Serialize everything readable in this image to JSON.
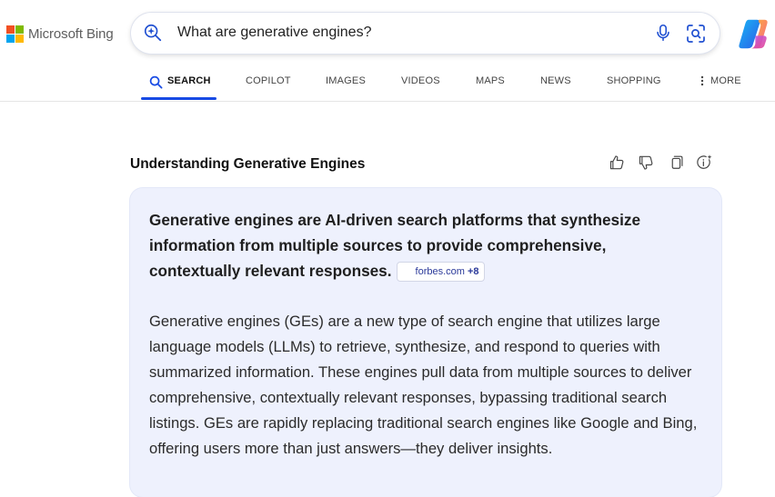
{
  "brand": {
    "logo_text": "Microsoft Bing",
    "logo_colors": [
      "#f25022",
      "#7fba00",
      "#00a4ef",
      "#ffb900"
    ]
  },
  "search": {
    "query": "What are generative engines?",
    "left_icon": "copilot-search-icon",
    "mic_icon": "microphone-icon",
    "visual_icon": "visual-search-icon"
  },
  "copilot_button_icon": "copilot-logo-icon",
  "tabs": [
    {
      "label": "SEARCH",
      "active": true,
      "icon": "search-icon"
    },
    {
      "label": "COPILOT"
    },
    {
      "label": "IMAGES"
    },
    {
      "label": "VIDEOS"
    },
    {
      "label": "MAPS"
    },
    {
      "label": "NEWS"
    },
    {
      "label": "SHOPPING"
    },
    {
      "label": "MORE",
      "icon": "more-vertical-icon"
    }
  ],
  "answer": {
    "heading": "Understanding Generative Engines",
    "feedback_icons": [
      "thumbs-up-icon",
      "thumbs-down-icon",
      "copy-icon",
      "sparkle-info-icon"
    ],
    "summary": "Generative engines are AI-driven search platforms that synthesize information from multiple sources to provide comprehensive, contextually relevant responses.",
    "citation": {
      "source": "forbes.com",
      "more": "+8"
    },
    "detail": "Generative engines (GEs) are a new type of search engine that utilizes large language models (LLMs) to retrieve, synthesize, and respond to queries with summarized information. These engines pull data from multiple sources to deliver comprehensive, contextually relevant responses, bypassing traditional search listings. GEs are rapidly replacing traditional search engines like Google and Bing, offering users more than just answers—they deliver insights."
  },
  "colors": {
    "accent": "#174ae4",
    "card_background": "#eef1fd"
  }
}
